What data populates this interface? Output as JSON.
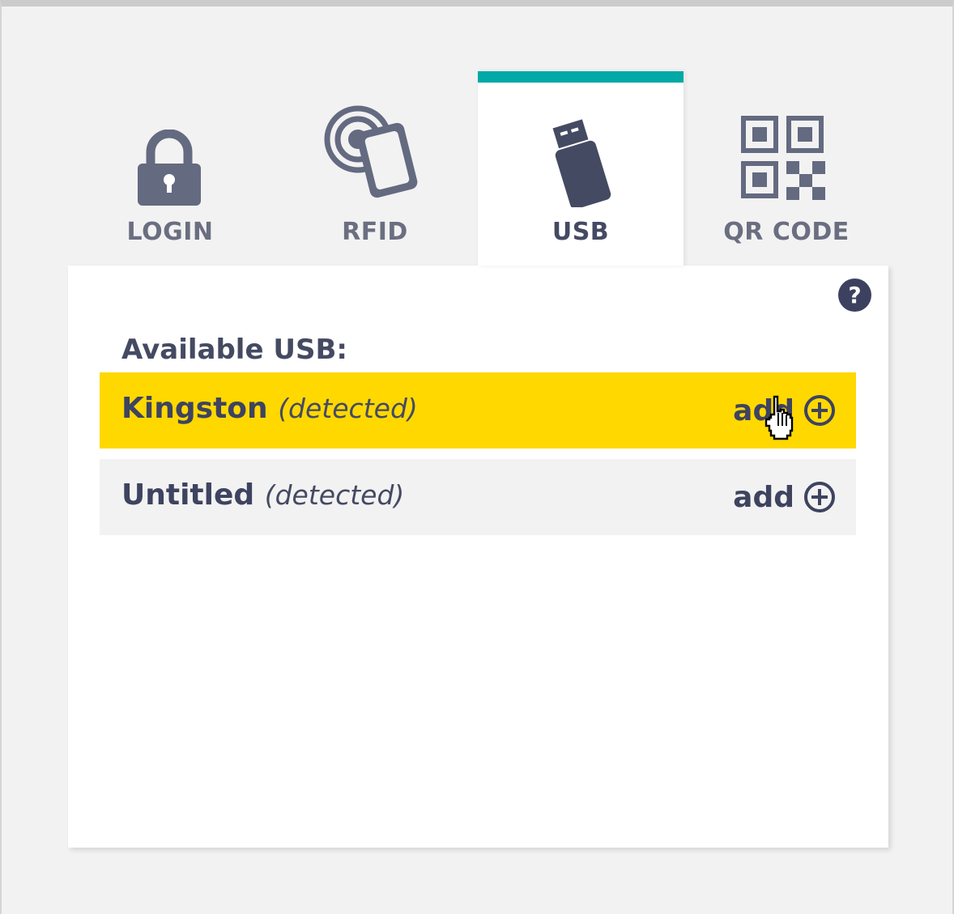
{
  "tabs": [
    {
      "label": "LOGIN",
      "icon": "lock-icon",
      "active": false
    },
    {
      "label": "RFID",
      "icon": "rfid-card-icon",
      "active": false
    },
    {
      "label": "USB",
      "icon": "usb-drive-icon",
      "active": true
    },
    {
      "label": "QR CODE",
      "icon": "qr-code-icon",
      "active": false
    }
  ],
  "panel": {
    "help_symbol": "?",
    "title": "Available USB:",
    "devices": [
      {
        "name": "Kingston",
        "status": "(detected)",
        "action": "add",
        "highlighted": true
      },
      {
        "name": "Untitled",
        "status": "(detected)",
        "action": "add",
        "highlighted": false
      }
    ]
  },
  "colors": {
    "accent": "#00a9a6",
    "highlight": "#ffd800",
    "row_bg": "#f2f2f2",
    "text_dark": "#3e4360",
    "icon": "#646a80"
  }
}
